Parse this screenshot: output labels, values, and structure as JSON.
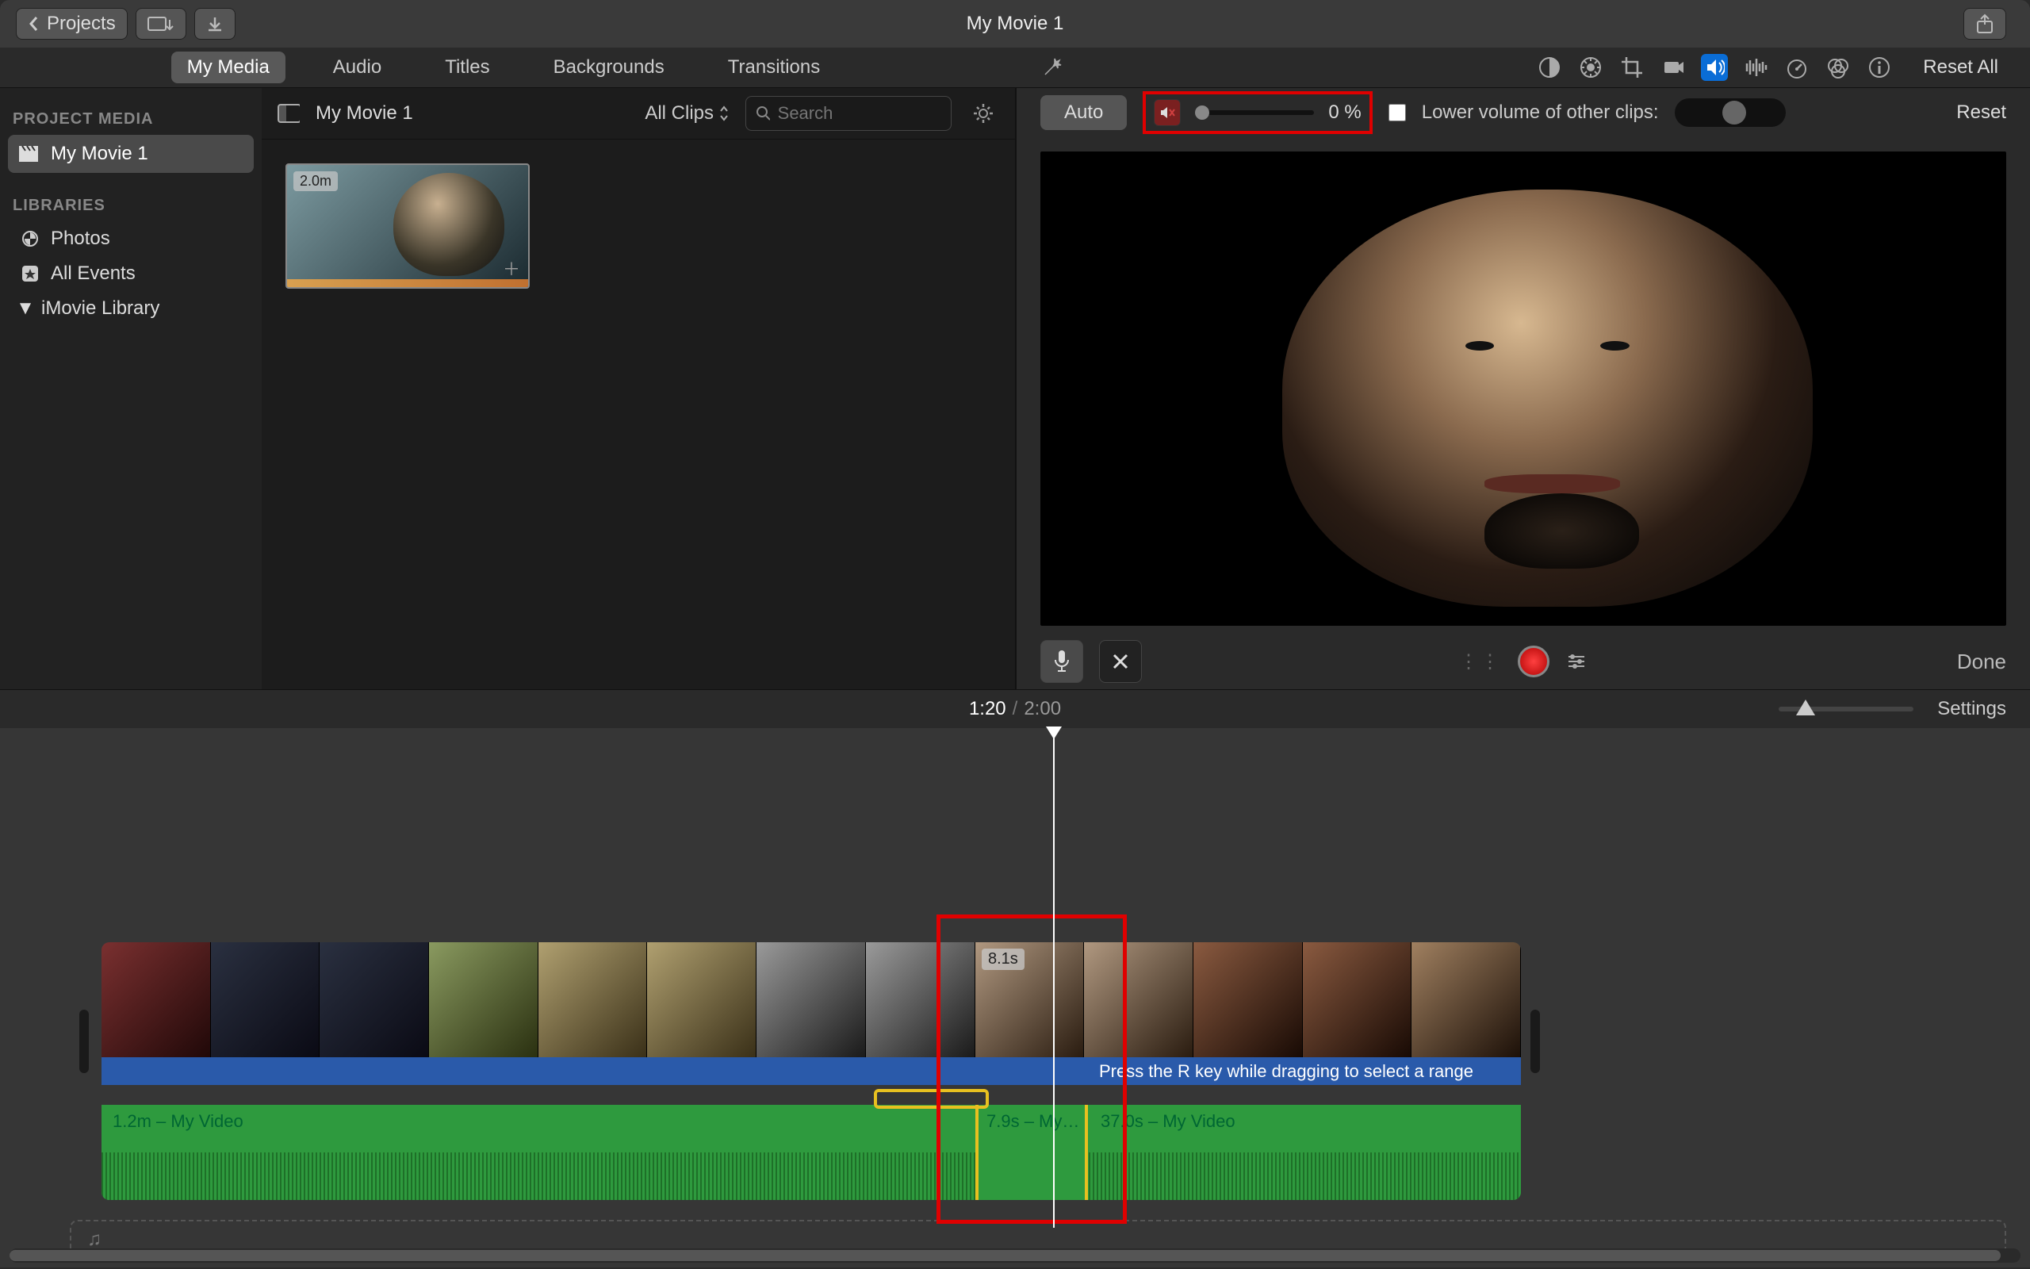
{
  "titlebar": {
    "back_label": "Projects",
    "title": "My Movie 1"
  },
  "tabs": {
    "my_media": "My Media",
    "audio": "Audio",
    "titles": "Titles",
    "backgrounds": "Backgrounds",
    "transitions": "Transitions",
    "reset_all": "Reset All"
  },
  "sidebar": {
    "section_project": "PROJECT MEDIA",
    "project_name": "My Movie 1",
    "section_libraries": "LIBRARIES",
    "photos": "Photos",
    "all_events": "All Events",
    "imovie_library": "iMovie Library"
  },
  "browser": {
    "title": "My Movie 1",
    "filter": "All Clips",
    "search_placeholder": "Search",
    "clip_duration": "2.0m"
  },
  "volume": {
    "auto": "Auto",
    "percent": "0 %",
    "lower_label": "Lower volume of other clips:",
    "reset": "Reset"
  },
  "record": {
    "done": "Done"
  },
  "timeline_header": {
    "current": "1:20",
    "total": "2:00",
    "settings": "Settings"
  },
  "timeline": {
    "title_hint": "Press the R key while dragging to select a range",
    "audio1_label": "1.2m – My Video",
    "audio2_label": "7.9s – My…",
    "audio3_label": "37.0s – My Video",
    "sel_clip_dur": "8.1s"
  }
}
